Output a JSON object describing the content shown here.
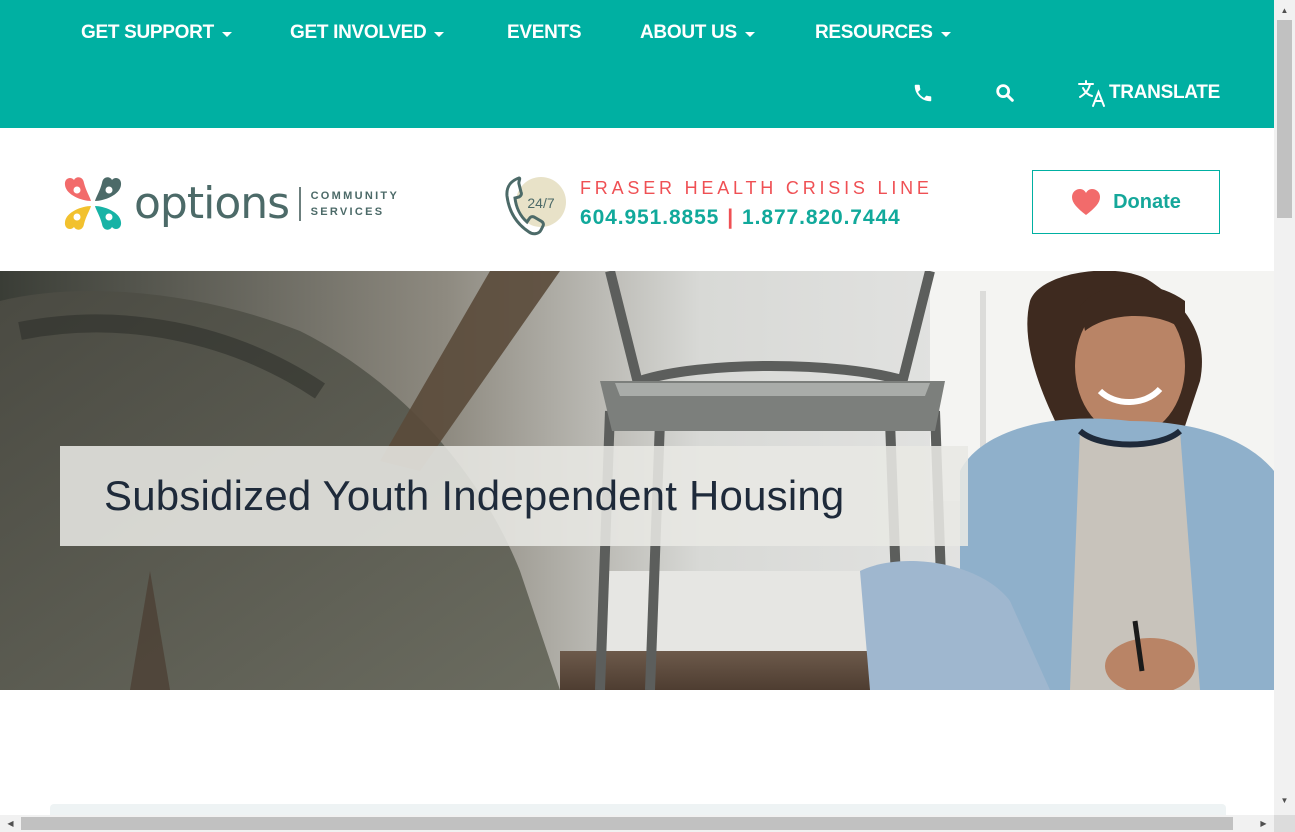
{
  "nav": {
    "items": [
      {
        "label": "GET SUPPORT",
        "dropdown": true
      },
      {
        "label": "GET INVOLVED",
        "dropdown": true
      },
      {
        "label": "EVENTS",
        "dropdown": false
      },
      {
        "label": "ABOUT US",
        "dropdown": true
      },
      {
        "label": "RESOURCES",
        "dropdown": true
      }
    ],
    "phone_icon": "phone-icon",
    "search_icon": "search-icon",
    "translate_icon": "translate-icon",
    "translate_label": "TRANSLATE"
  },
  "header": {
    "logo": {
      "wordmark": "options",
      "sub_line1": "COMMUNITY",
      "sub_line2": "SERVICES"
    },
    "crisis": {
      "badge": "24/7",
      "title": "FRASER HEALTH CRISIS LINE",
      "phone1": "604.951.8855",
      "separator": "|",
      "phone2": "1.877.820.7444"
    },
    "donate": {
      "label": "Donate",
      "icon": "heart-icon"
    }
  },
  "hero": {
    "title": "Subsidized Youth Independent Housing"
  },
  "colors": {
    "teal": "#00b0a2",
    "coral": "#ef5054",
    "heart": "#f26b6b",
    "title_text": "#1e2a3a"
  }
}
